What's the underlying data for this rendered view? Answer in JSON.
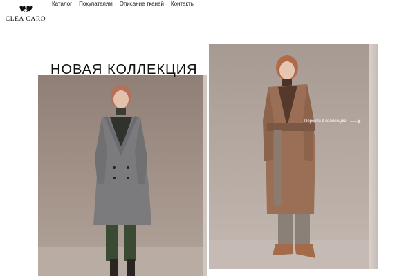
{
  "brand": {
    "name": "CLEA CARO"
  },
  "nav": {
    "items": [
      {
        "label": "Каталог"
      },
      {
        "label": "Покупателям"
      },
      {
        "label": "Описание тканей"
      },
      {
        "label": "Контакты"
      }
    ]
  },
  "hero": {
    "title": "НОВАЯ КОЛЛЕКЦИЯ",
    "cta_label": "Перейти в коллекцию",
    "cta_icon": "arrow-right-icon"
  },
  "colors": {
    "text": "#1a1a1a",
    "background": "#ffffff",
    "cta_text": "#ffffff"
  }
}
